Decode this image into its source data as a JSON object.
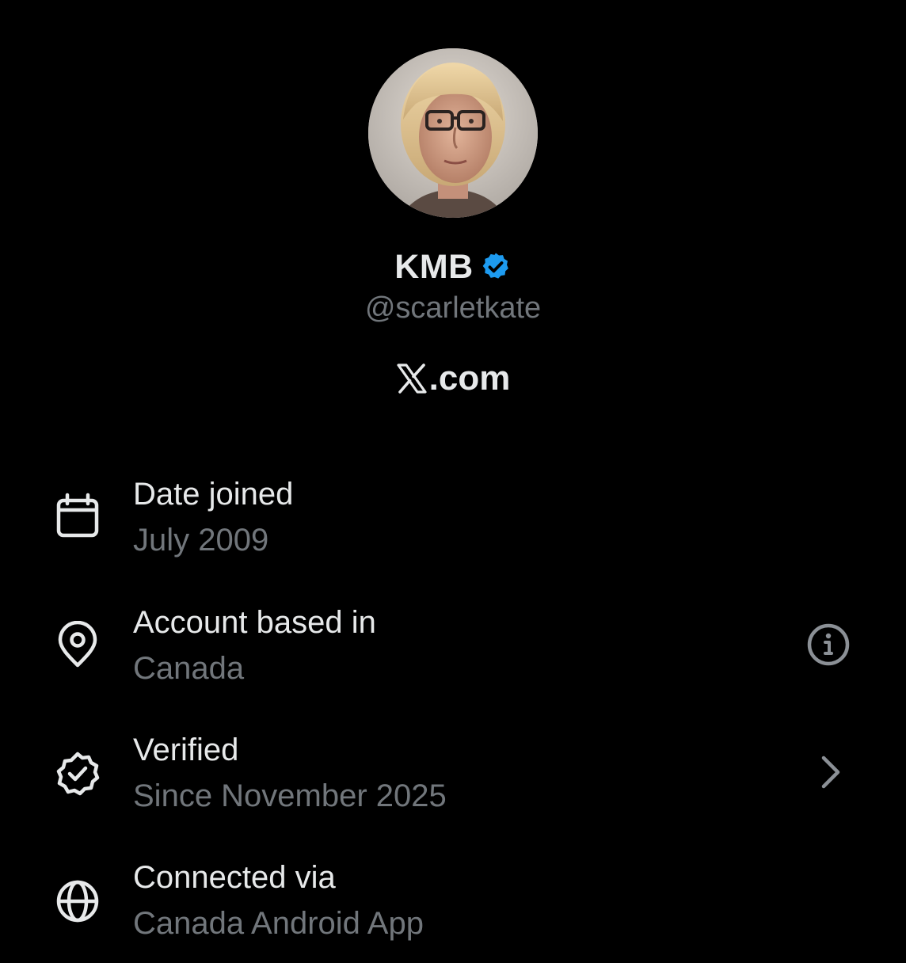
{
  "profile": {
    "display_name": "KMB",
    "handle": "@scarletkate",
    "site_suffix": ".com",
    "verified_badge_color": "#1d9bf0"
  },
  "details": [
    {
      "title": "Date joined",
      "value": "July 2009",
      "icon": "calendar-icon"
    },
    {
      "title": "Account based in",
      "value": "Canada",
      "icon": "location-pin-icon",
      "action_icon": "info-icon"
    },
    {
      "title": "Verified",
      "value": "Since November 2025",
      "icon": "verified-check-icon",
      "action_icon": "chevron-right-icon"
    },
    {
      "title": "Connected via",
      "value": "Canada Android App",
      "icon": "globe-icon"
    }
  ],
  "colors": {
    "background": "#000000",
    "primary_text": "#e7e9ea",
    "secondary_text": "#71767b",
    "accent": "#1d9bf0"
  }
}
